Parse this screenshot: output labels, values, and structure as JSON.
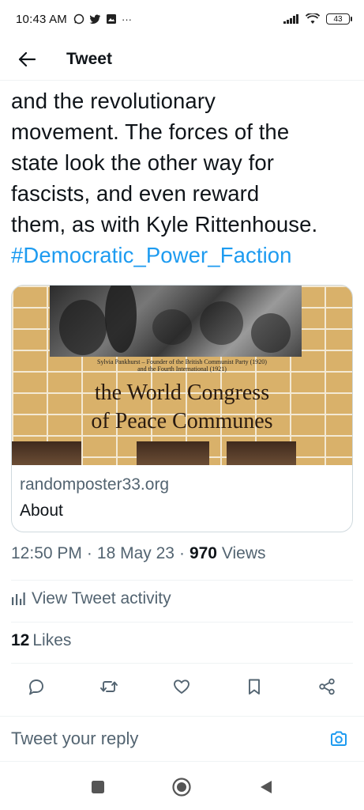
{
  "status_bar": {
    "time": "10:43 AM",
    "battery": "43",
    "more": "···"
  },
  "header": {
    "title": "Tweet"
  },
  "tweet": {
    "text_lines": [
      "and the revolutionary",
      "movement. The forces of the",
      "state look the other way for",
      "fascists, and even reward",
      "them, as with Kyle Rittenhouse."
    ],
    "hashtag": "#Democratic_Power_Faction",
    "hashtag_color": "#1d9bf0"
  },
  "card": {
    "caption_line1": "Sylvia Pankhurst – Founder of the British Communist Party (1920)",
    "caption_line2": "and the Fourth International (1921)",
    "headline_line1": "the World Congress",
    "headline_line2": "of Peace Communes",
    "domain": "randomposter33.org",
    "about": "About",
    "background_color": "#d9b16a"
  },
  "meta": {
    "time": "12:50 PM",
    "separator": "·",
    "date": "18 May 23",
    "views_count": "970",
    "views_label": "Views"
  },
  "activity": {
    "label": "View Tweet activity"
  },
  "likes": {
    "count": "12",
    "label": "Likes"
  },
  "actions": [
    "reply-icon",
    "retweet-icon",
    "like-icon",
    "bookmark-icon",
    "share-icon"
  ],
  "reply_bar": {
    "placeholder": "Tweet your reply",
    "accent": "#1d9bf0"
  }
}
